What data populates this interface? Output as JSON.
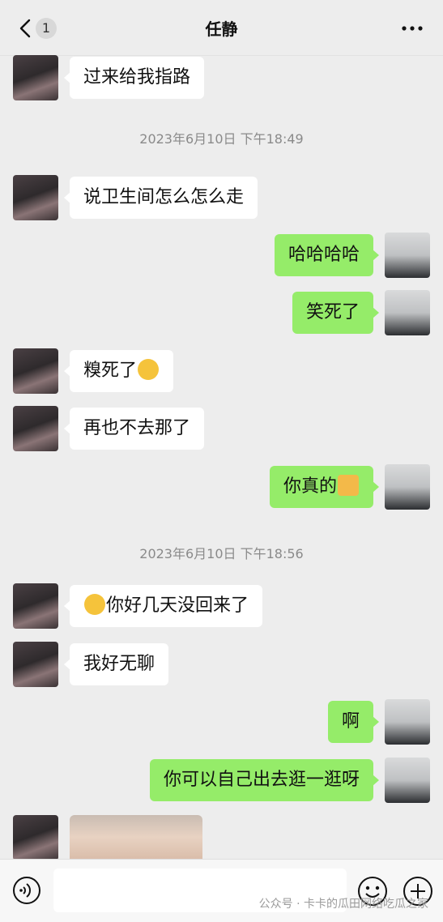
{
  "header": {
    "unread_count": "1",
    "title": "任静"
  },
  "messages": [
    {
      "side": "left",
      "text": "过来给我指路"
    },
    {
      "timestamp": "2023年6月10日 下午18:49"
    },
    {
      "side": "left",
      "text": "说卫生间怎么怎么走"
    },
    {
      "side": "right",
      "text": "哈哈哈哈"
    },
    {
      "side": "right",
      "text": "笑死了"
    },
    {
      "side": "left",
      "text": "糗死了",
      "emoji_after": "pensive-face"
    },
    {
      "side": "left",
      "text": "再也不去那了"
    },
    {
      "side": "right",
      "text": "你真的",
      "emoji_after": "thumbs-up"
    },
    {
      "timestamp": "2023年6月10日 下午18:56"
    },
    {
      "side": "left",
      "text": "你好几天没回来了",
      "emoji_before": "frowning-face"
    },
    {
      "side": "left",
      "text": "我好无聊"
    },
    {
      "side": "right",
      "text": "啊"
    },
    {
      "side": "right",
      "text": "你可以自己出去逛一逛呀"
    },
    {
      "side": "left",
      "type": "image"
    }
  ],
  "ts1": "2023年6月10日 下午18:49",
  "ts2": "2023年6月10日 下午18:56",
  "m1": "过来给我指路",
  "m2": "说卫生间怎么怎么走",
  "m3": "哈哈哈哈",
  "m4": "笑死了",
  "m5": "糗死了",
  "m6": "再也不去那了",
  "m7": "你真的",
  "m8": "你好几天没回来了",
  "m9": "我好无聊",
  "m10": "啊",
  "m11": "你可以自己出去逛一逛呀",
  "watermark": "公众号 · 卡卡的瓜田网络吃瓜之家",
  "colors": {
    "background": "#ededed",
    "my_bubble": "#95ec69",
    "their_bubble": "#ffffff"
  }
}
